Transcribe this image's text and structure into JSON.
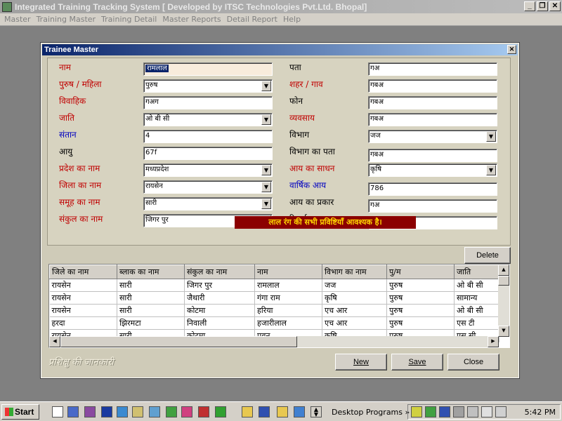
{
  "app": {
    "title": "Integrated Training Tracking System    [ Developed by ITSC Technologies Pvt.Ltd. Bhopal]",
    "menu": [
      "Master",
      "Training Master",
      "Training Detail",
      "Master Reports",
      "Detail Report",
      "Help"
    ]
  },
  "dialog": {
    "title": "Trainee Master",
    "left_fields": [
      {
        "label": "नाम",
        "value": "रामलाल",
        "color": "red",
        "type": "text",
        "selected": true
      },
      {
        "label": "पुरुष / महिला",
        "value": "पुरुष",
        "color": "red",
        "type": "combo"
      },
      {
        "label": "विवाहिक",
        "value": "गअग",
        "color": "red",
        "type": "text"
      },
      {
        "label": "जाति",
        "value": "ओ बी सी",
        "color": "red",
        "type": "combo"
      },
      {
        "label": "संतान",
        "value": "4",
        "color": "blue",
        "type": "text"
      },
      {
        "label": "आयु",
        "value": "67f",
        "color": "black",
        "type": "text"
      },
      {
        "label": "प्रदेश का नाम",
        "value": "मध्यप्रदेश",
        "color": "red",
        "type": "combo"
      },
      {
        "label": "जिला का नाम",
        "value": "रायसेन",
        "color": "red",
        "type": "combo"
      },
      {
        "label": "समूह का नाम",
        "value": "सारी",
        "color": "red",
        "type": "combo"
      },
      {
        "label": "संकुल का नाम",
        "value": "जिगर पुर",
        "color": "red",
        "type": "combo"
      }
    ],
    "right_fields": [
      {
        "label": "पता",
        "value": "गअ",
        "color": "black",
        "type": "text"
      },
      {
        "label": "शहर / गाव",
        "value": "गबअ",
        "color": "red",
        "type": "text"
      },
      {
        "label": "फोन",
        "value": "गबअ",
        "color": "black",
        "type": "text"
      },
      {
        "label": "व्यवसाय",
        "value": "गबअ",
        "color": "red",
        "type": "text"
      },
      {
        "label": "विभाग",
        "value": "जज",
        "color": "black",
        "type": "combo"
      },
      {
        "label": "विभाग का पता",
        "value": "गबअ",
        "color": "black",
        "type": "text"
      },
      {
        "label": "आय का साधन",
        "value": "कृषि",
        "color": "red",
        "type": "combo"
      },
      {
        "label": "वार्षिक आय",
        "value": "786",
        "color": "blue",
        "type": "text"
      },
      {
        "label": "आय का प्रकार",
        "value": "गअ",
        "color": "black",
        "type": "text"
      },
      {
        "label": "रिमार्क",
        "value": "गबअ",
        "color": "black",
        "type": "text"
      }
    ],
    "required_note": "लाल रंग की सभी प्रविष्टियाँ आवश्यक है।",
    "delete_label": "Delete",
    "grid": {
      "columns": [
        "जिले का नाम",
        "ब्लाक का नाम",
        "संकुल का नाम",
        "नाम",
        "विभाग का नाम",
        "पु/म",
        "जाति"
      ],
      "rows": [
        [
          "रायसेन",
          "सारी",
          "जिगर पुर",
          "रामलाल",
          "जज",
          "पुरुष",
          "ओ बी सी"
        ],
        [
          "रायसेन",
          "सारी",
          "जैथारी",
          "गंगा राम",
          "कृषि",
          "पुरुष",
          "सामान्य"
        ],
        [
          "रायसेन",
          "सारी",
          "कोटमा",
          "हरिया",
          "एच आर",
          "पुरुष",
          "ओ बी सी"
        ],
        [
          "हरदा",
          "झिरमटा",
          "निवाली",
          "हजारीलाल",
          "एच आर",
          "पुरुष",
          "एस टी"
        ],
        [
          "रायसेन",
          "सारी",
          "कोटमा",
          "पवन",
          "कृषि",
          "पुरुष",
          "एस सी"
        ]
      ]
    },
    "footer_text": "प्रशिक्षु की जानकारी",
    "buttons": {
      "new": "New",
      "save": "Save",
      "close": "Close"
    }
  },
  "taskbar": {
    "start_label": "Start",
    "desktop_programs": "Desktop Programs",
    "clock": "5:42 PM"
  },
  "colors": {
    "required": "#c00000",
    "optional": "#000000",
    "numeric": "#0000c0",
    "note_bg": "#8b0000",
    "note_text": "#ffd700"
  }
}
